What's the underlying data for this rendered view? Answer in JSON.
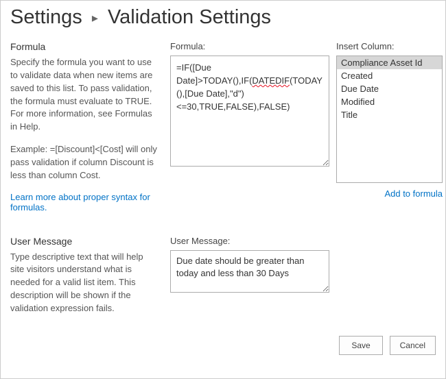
{
  "breadcrumb": {
    "parent": "Settings",
    "current": "Validation Settings"
  },
  "formula_section": {
    "title": "Formula",
    "description": "Specify the formula you want to use to validate data when new items are saved to this list. To pass validation, the formula must evaluate to TRUE. For more information, see Formulas in Help.",
    "example": "Example: =[Discount]<[Cost] will only pass validation if column Discount is less than column Cost.",
    "syntax_link": "Learn more about proper syntax for formulas.",
    "formula_label": "Formula:",
    "formula_value_pre": "=IF([Due Date]>TODAY(),IF(",
    "formula_value_squiggle": "DATEDIF",
    "formula_value_post": "(TODAY(),[Due Date],\"d\")<=30,TRUE,FALSE),FALSE)",
    "insert_label": "Insert Column:",
    "columns": [
      "Compliance Asset Id",
      "Created",
      "Due Date",
      "Modified",
      "Title"
    ],
    "selected_index": 0,
    "add_link": "Add to formula"
  },
  "message_section": {
    "title": "User Message",
    "description": "Type descriptive text that will help site visitors understand what is needed for a valid list item. This description will be shown if the validation expression fails.",
    "label": "User Message:",
    "value": "Due date should be greater than today and less than 30 Days"
  },
  "buttons": {
    "save": "Save",
    "cancel": "Cancel"
  }
}
